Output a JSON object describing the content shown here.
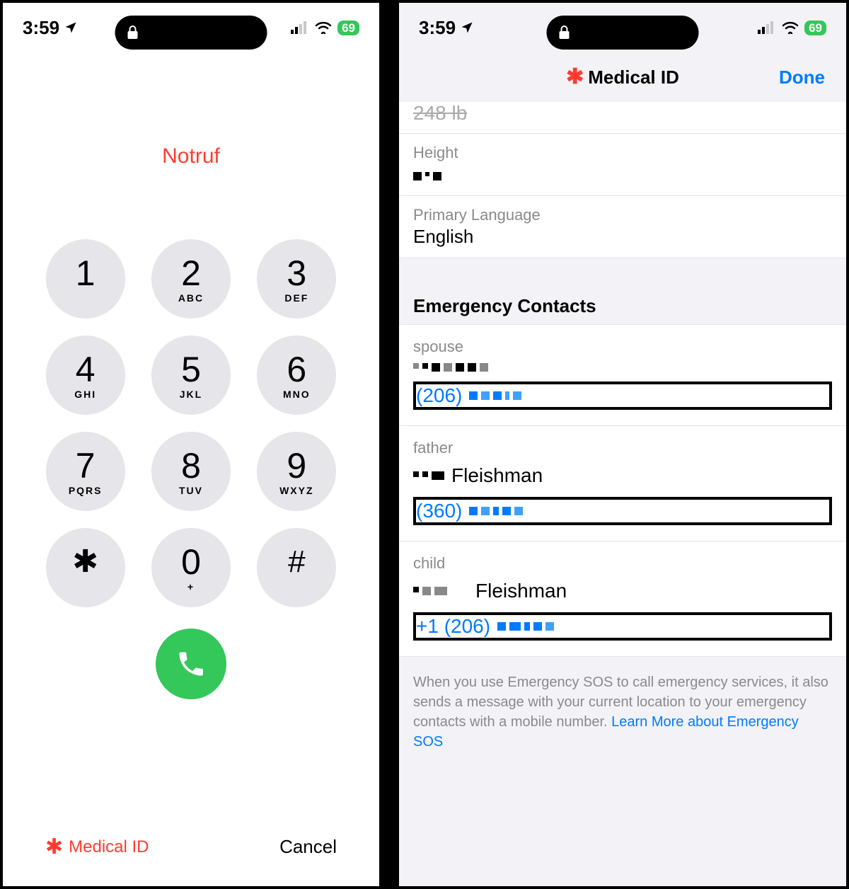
{
  "status": {
    "time": "3:59",
    "battery": "69"
  },
  "left": {
    "title": "Notruf",
    "keys": [
      {
        "d": "1",
        "l": ""
      },
      {
        "d": "2",
        "l": "ABC"
      },
      {
        "d": "3",
        "l": "DEF"
      },
      {
        "d": "4",
        "l": "GHI"
      },
      {
        "d": "5",
        "l": "JKL"
      },
      {
        "d": "6",
        "l": "MNO"
      },
      {
        "d": "7",
        "l": "PQRS"
      },
      {
        "d": "8",
        "l": "TUV"
      },
      {
        "d": "9",
        "l": "WXYZ"
      },
      {
        "d": "✱",
        "l": ""
      },
      {
        "d": "0",
        "l": "+"
      },
      {
        "d": "#",
        "l": ""
      }
    ],
    "medical_id": "Medical ID",
    "cancel": "Cancel"
  },
  "right": {
    "title": "Medical ID",
    "done": "Done",
    "weight_cut": "248 lb",
    "height_label": "Height",
    "height_value": "",
    "lang_label": "Primary Language",
    "lang_value": "English",
    "section": "Emergency Contacts",
    "contacts": [
      {
        "rel": "spouse",
        "name_suffix": "",
        "phone_prefix": "(206)"
      },
      {
        "rel": "father",
        "name_suffix": "Fleishman",
        "phone_prefix": "(360)"
      },
      {
        "rel": "child",
        "name_suffix": "Fleishman",
        "phone_prefix": "+1 (206)"
      }
    ],
    "note_text": "When you use Emergency SOS to call emergency services, it also sends a message with your current location to your emergency contacts with a mobile number. ",
    "note_link": "Learn More about Emergency SOS"
  }
}
